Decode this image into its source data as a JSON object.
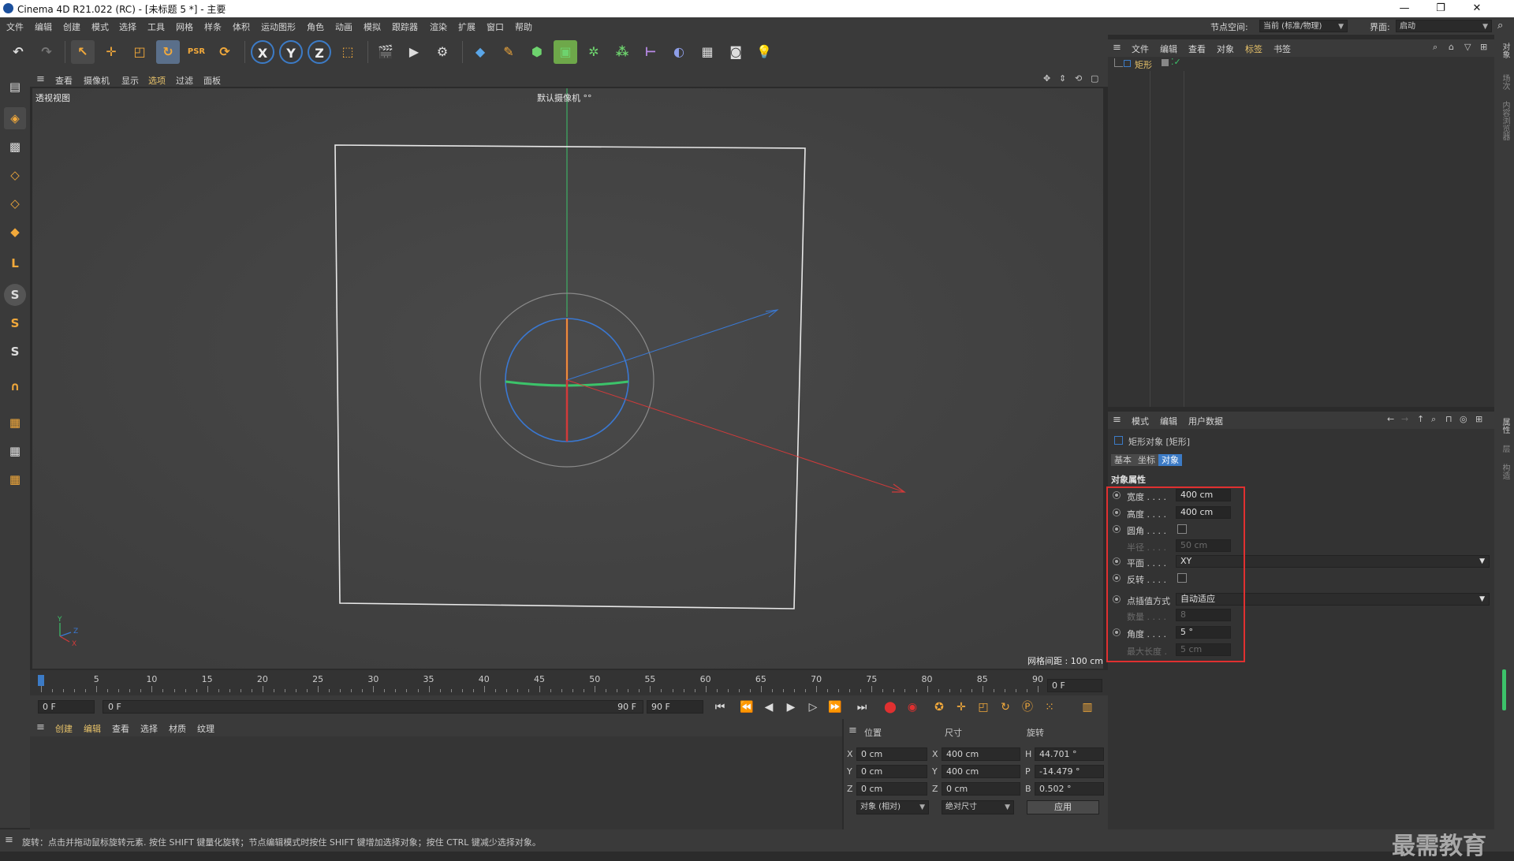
{
  "window": {
    "title": "Cinema 4D R21.022 (RC) - [未标题 5 *] - 主要",
    "min": "—",
    "max": "❐",
    "close": "✕"
  },
  "menu": [
    "文件",
    "编辑",
    "创建",
    "模式",
    "选择",
    "工具",
    "网格",
    "样条",
    "体积",
    "运动图形",
    "角色",
    "动画",
    "模拟",
    "跟踪器",
    "渲染",
    "扩展",
    "窗口",
    "帮助"
  ],
  "node_space": {
    "label": "节点空间:",
    "value": "当前 (标准/物理)"
  },
  "layout": {
    "label": "界面:",
    "value": "启动"
  },
  "viewport": {
    "menu": [
      "查看",
      "摄像机",
      "显示",
      "选项",
      "过滤",
      "面板"
    ],
    "view_name": "透视视图",
    "camera_label": "默认摄像机 °°",
    "grid_spacing": "网格间距 : 100 cm",
    "axis_y": "Y",
    "axis_z": "Z",
    "axis_x": "X"
  },
  "timeline": {
    "ticks": [
      "0",
      "5",
      "10",
      "15",
      "20",
      "25",
      "30",
      "35",
      "40",
      "45",
      "50",
      "55",
      "60",
      "65",
      "70",
      "75",
      "80",
      "85",
      "90"
    ],
    "current_frame": "0 F",
    "start_field": "0 F",
    "range_start": "0 F",
    "range_end": "90 F",
    "end_field": "90 F"
  },
  "material_manager": {
    "menu": [
      "创建",
      "编辑",
      "查看",
      "选择",
      "材质",
      "纹理"
    ]
  },
  "coordinates": {
    "headers": [
      "位置",
      "尺寸",
      "旋转"
    ],
    "rows": [
      {
        "axis": "X",
        "pos": "0 cm",
        "size_axis": "X",
        "size": "400 cm",
        "rot_axis": "H",
        "rot": "44.701 °"
      },
      {
        "axis": "Y",
        "pos": "0 cm",
        "size_axis": "Y",
        "size": "400 cm",
        "rot_axis": "P",
        "rot": "-14.479 °"
      },
      {
        "axis": "Z",
        "pos": "0 cm",
        "size_axis": "Z",
        "size": "0 cm",
        "rot_axis": "B",
        "rot": "0.502 °"
      }
    ],
    "mode": "对象 (相对)",
    "size_mode": "绝对尺寸",
    "apply": "应用"
  },
  "object_manager": {
    "menu": [
      "文件",
      "编辑",
      "查看",
      "对象",
      "标签",
      "书签"
    ],
    "objects": [
      {
        "name": "矩形"
      }
    ]
  },
  "attributes": {
    "menu": [
      "模式",
      "编辑",
      "用户数据"
    ],
    "object_title": "矩形对象 [矩形]",
    "tabs": [
      "基本",
      "坐标",
      "对象"
    ],
    "active_tab": 2,
    "section": "对象属性",
    "props": [
      {
        "label": "宽度 . . . .",
        "value": "400 cm",
        "type": "num",
        "enabled": true
      },
      {
        "label": "高度 . . . .",
        "value": "400 cm",
        "type": "num",
        "enabled": true
      },
      {
        "label": "圆角 . . . .",
        "value": "",
        "type": "check",
        "enabled": true
      },
      {
        "label": "半径 . . . .",
        "value": "50 cm",
        "type": "num",
        "enabled": false
      },
      {
        "label": "平面 . . . .",
        "value": "XY",
        "type": "select",
        "enabled": true
      },
      {
        "label": "反转 . . . .",
        "value": "",
        "type": "check",
        "enabled": true
      },
      {
        "label": "点插值方式",
        "value": "自动适应",
        "type": "select",
        "enabled": true
      },
      {
        "label": "数量 . . . .",
        "value": "8",
        "type": "num",
        "enabled": false
      },
      {
        "label": "角度 . . . .",
        "value": "5 °",
        "type": "num",
        "enabled": true
      },
      {
        "label": "最大长度 .",
        "value": "5 cm",
        "type": "num",
        "enabled": false
      }
    ]
  },
  "right_strip_tabs": [
    "对象",
    "场次",
    "内容浏览器",
    "属性",
    "层",
    "构造"
  ],
  "status": "旋转：点击并拖动鼠标旋转元素. 按住 SHIFT 键量化旋转；节点编辑模式时按住 SHIFT 键增加选择对象；按住 CTRL 键减少选择对象。",
  "watermark": "最需教育",
  "colors": {
    "accent": "#3c7bc6",
    "highlight": "#e03030",
    "axis_x": "#d23a3a",
    "axis_y": "#3cc36a",
    "axis_z": "#3a78d2"
  }
}
